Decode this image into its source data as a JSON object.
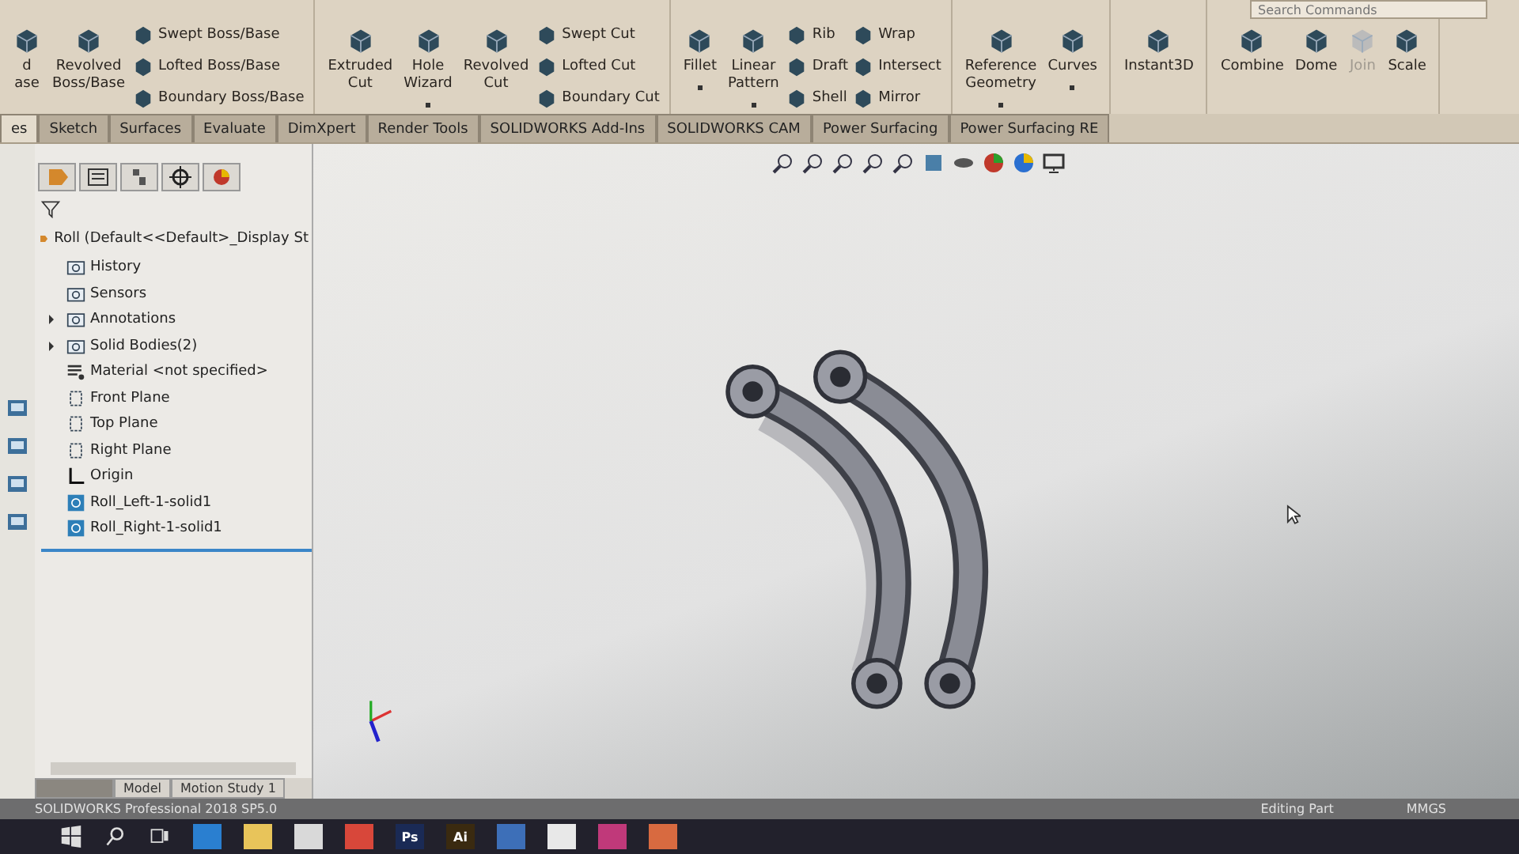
{
  "ribbon": {
    "groups": [
      {
        "items": [
          {
            "kind": "big",
            "lines": [
              "d",
              "ase"
            ],
            "dropdown": false,
            "disabled": false
          },
          {
            "kind": "big",
            "lines": [
              "Revolved",
              "Boss/Base"
            ],
            "dropdown": false,
            "disabled": false
          },
          {
            "kind": "stack",
            "entries": [
              "Swept Boss/Base",
              "Lofted Boss/Base",
              "Boundary Boss/Base"
            ]
          }
        ]
      },
      {
        "items": [
          {
            "kind": "big",
            "lines": [
              "Extruded",
              "Cut"
            ],
            "dropdown": false,
            "disabled": false
          },
          {
            "kind": "big",
            "lines": [
              "Hole",
              "Wizard"
            ],
            "dropdown": true,
            "disabled": false
          },
          {
            "kind": "big",
            "lines": [
              "Revolved",
              "Cut"
            ],
            "dropdown": false,
            "disabled": false
          },
          {
            "kind": "stack",
            "entries": [
              "Swept Cut",
              "Lofted Cut",
              "Boundary Cut"
            ]
          }
        ]
      },
      {
        "items": [
          {
            "kind": "big",
            "lines": [
              "Fillet"
            ],
            "dropdown": true,
            "disabled": false
          },
          {
            "kind": "big",
            "lines": [
              "Linear",
              "Pattern"
            ],
            "dropdown": true,
            "disabled": false
          },
          {
            "kind": "stack",
            "entries": [
              "Rib",
              "Draft",
              "Shell"
            ]
          },
          {
            "kind": "stack",
            "entries": [
              "Wrap",
              "Intersect",
              "Mirror"
            ]
          }
        ]
      },
      {
        "items": [
          {
            "kind": "big",
            "lines": [
              "Reference",
              "Geometry"
            ],
            "dropdown": true,
            "disabled": false
          },
          {
            "kind": "big",
            "lines": [
              "Curves"
            ],
            "dropdown": true,
            "disabled": false
          }
        ]
      },
      {
        "items": [
          {
            "kind": "big",
            "lines": [
              "Instant3D"
            ],
            "dropdown": false,
            "disabled": false
          }
        ]
      },
      {
        "items": [
          {
            "kind": "big",
            "lines": [
              "Combine"
            ],
            "dropdown": false,
            "disabled": false
          },
          {
            "kind": "big",
            "lines": [
              "Dome"
            ],
            "dropdown": false,
            "disabled": false
          },
          {
            "kind": "big",
            "lines": [
              "Join"
            ],
            "dropdown": false,
            "disabled": true
          },
          {
            "kind": "big",
            "lines": [
              "Scale"
            ],
            "dropdown": false,
            "disabled": false
          }
        ]
      }
    ]
  },
  "search": {
    "placeholder": "Search Commands"
  },
  "tabs": [
    {
      "label": "es",
      "selected": true
    },
    {
      "label": "Sketch",
      "selected": false
    },
    {
      "label": "Surfaces",
      "selected": false
    },
    {
      "label": "Evaluate",
      "selected": false
    },
    {
      "label": "DimXpert",
      "selected": false
    },
    {
      "label": "Render Tools",
      "selected": false
    },
    {
      "label": "SOLIDWORKS Add-Ins",
      "selected": false
    },
    {
      "label": "SOLIDWORKS CAM",
      "selected": false
    },
    {
      "label": "Power Surfacing",
      "selected": false
    },
    {
      "label": "Power Surfacing RE",
      "selected": false
    }
  ],
  "feature_tree": {
    "root": "Roll  (Default<<Default>_Display St",
    "items": [
      {
        "kind": "folder",
        "label": "History",
        "has_children": false
      },
      {
        "kind": "folder",
        "label": "Sensors",
        "has_children": false
      },
      {
        "kind": "folder",
        "label": "Annotations",
        "has_children": true
      },
      {
        "kind": "folder",
        "label": "Solid Bodies(2)",
        "has_children": true
      },
      {
        "kind": "material",
        "label": "Material <not specified>",
        "has_children": false
      },
      {
        "kind": "plane",
        "label": "Front Plane",
        "has_children": false
      },
      {
        "kind": "plane",
        "label": "Top Plane",
        "has_children": false
      },
      {
        "kind": "plane",
        "label": "Right Plane",
        "has_children": false
      },
      {
        "kind": "origin",
        "label": "Origin",
        "has_children": false
      },
      {
        "kind": "body",
        "label": "Roll_Left-1-solid1",
        "has_children": false
      },
      {
        "kind": "body",
        "label": "Roll_Right-1-solid1",
        "has_children": false
      }
    ]
  },
  "bottom_tabs": [
    {
      "selected": true
    },
    {
      "label": "Model",
      "selected": false
    },
    {
      "label": "Motion Study 1",
      "selected": false
    }
  ],
  "status_bar": {
    "product": "SOLIDWORKS Professional 2018 SP5.0",
    "mode": "Editing Part",
    "units": "MMGS"
  },
  "taskbar": [
    {
      "kind": "windows"
    },
    {
      "kind": "search"
    },
    {
      "kind": "taskview"
    },
    {
      "kind": "app",
      "color": "#2a7fd0"
    },
    {
      "kind": "app",
      "color": "#e8c45a"
    },
    {
      "kind": "app",
      "color": "#d9d9d9"
    },
    {
      "kind": "app",
      "color": "#d8473a"
    },
    {
      "kind": "app",
      "color": "#1a2a55",
      "label": "Ps"
    },
    {
      "kind": "app",
      "color": "#3a2a10",
      "label": "Ai"
    },
    {
      "kind": "app",
      "color": "#3d6fb8"
    },
    {
      "kind": "app",
      "color": "#e8e8e8"
    },
    {
      "kind": "app",
      "color": "#c0397a"
    },
    {
      "kind": "app",
      "color": "#d86a40"
    }
  ]
}
